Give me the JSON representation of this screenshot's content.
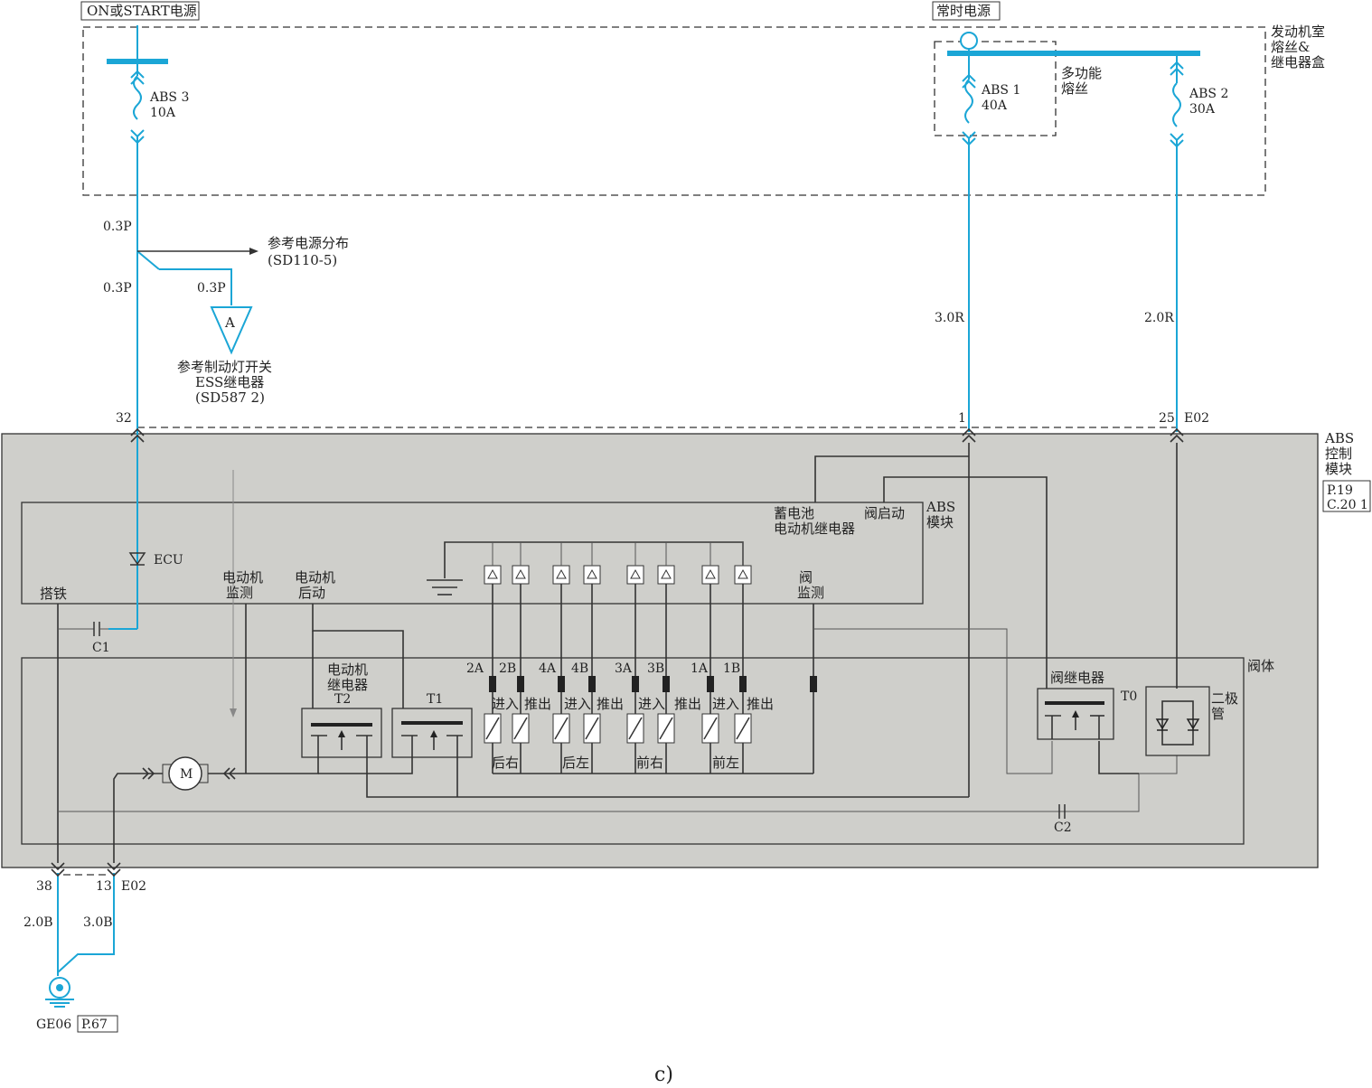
{
  "power": {
    "ign_source": "ON或START电源",
    "constant_source": "常时电源"
  },
  "fuse_box": {
    "title_l1": "发动机室",
    "title_l2": "熔丝&",
    "title_l3": "继电器盒",
    "multi_fuse_l1": "多功能",
    "multi_fuse_l2": "熔丝",
    "fuses": [
      {
        "name": "ABS 3",
        "rating": "10A"
      },
      {
        "name": "ABS 1",
        "rating": "40A"
      },
      {
        "name": "ABS 2",
        "rating": "30A"
      }
    ]
  },
  "wires": {
    "w_03p_top": "0.3P",
    "w_03p_mid": "0.3P",
    "w_03p_branch": "0.3P",
    "w_30r": "3.0R",
    "w_20r": "2.0R",
    "w_20b": "2.0B",
    "w_30b": "3.0B"
  },
  "refs": {
    "power_dist_l1": "参考电源分布",
    "power_dist_l2": "(SD110-5)",
    "connector_a": "A",
    "brake_l1": "参考制动灯开关",
    "brake_l2": "ESS继电器",
    "brake_l3": "(SD587 2)"
  },
  "pins": {
    "p32": "32",
    "p1": "1",
    "p25": "25",
    "e02_top": "E02",
    "p38": "38",
    "p13": "13",
    "e02_bottom": "E02"
  },
  "module": {
    "title_l1": "ABS",
    "title_l2": "控制",
    "title_l3": "模块",
    "page_ref_1": "P.19",
    "page_ref_2": "C.20 1",
    "abs_block_l1": "ABS",
    "abs_block_l2": "模块",
    "ecu": "ECU",
    "ground": "搭铁",
    "motor_monitor_l1": "电动机",
    "motor_monitor_l2": "监测",
    "motor_start_l1": "电动机",
    "motor_start_l2": "后动",
    "battery_relay_l1": "蓄电池",
    "battery_relay_l2": "电动机继电器",
    "valve_start": "阀启动",
    "valve_monitor_l1": "阀",
    "valve_monitor_l2": "监测",
    "c1": "C1",
    "c2": "C2",
    "motor": "M"
  },
  "valve_body": {
    "title": "阀体",
    "motor_relay_l1": "电动机",
    "motor_relay_l2": "继电器",
    "t2": "T2",
    "t1": "T1",
    "t0": "T0",
    "valve_relay": "阀继电器",
    "diode_l1": "二极",
    "diode_l2": "管",
    "valve_pins": [
      "2A",
      "2B",
      "4A",
      "4B",
      "3A",
      "3B",
      "1A",
      "1B"
    ],
    "valve_io": [
      "进入",
      "推出",
      "进入",
      "推出",
      "进入",
      "推出",
      "进入",
      "推出"
    ],
    "wheels": [
      "后右",
      "后左",
      "前右",
      "前左"
    ]
  },
  "ground_ref": {
    "name": "GE06",
    "page": "P.67"
  },
  "caption": "c)"
}
